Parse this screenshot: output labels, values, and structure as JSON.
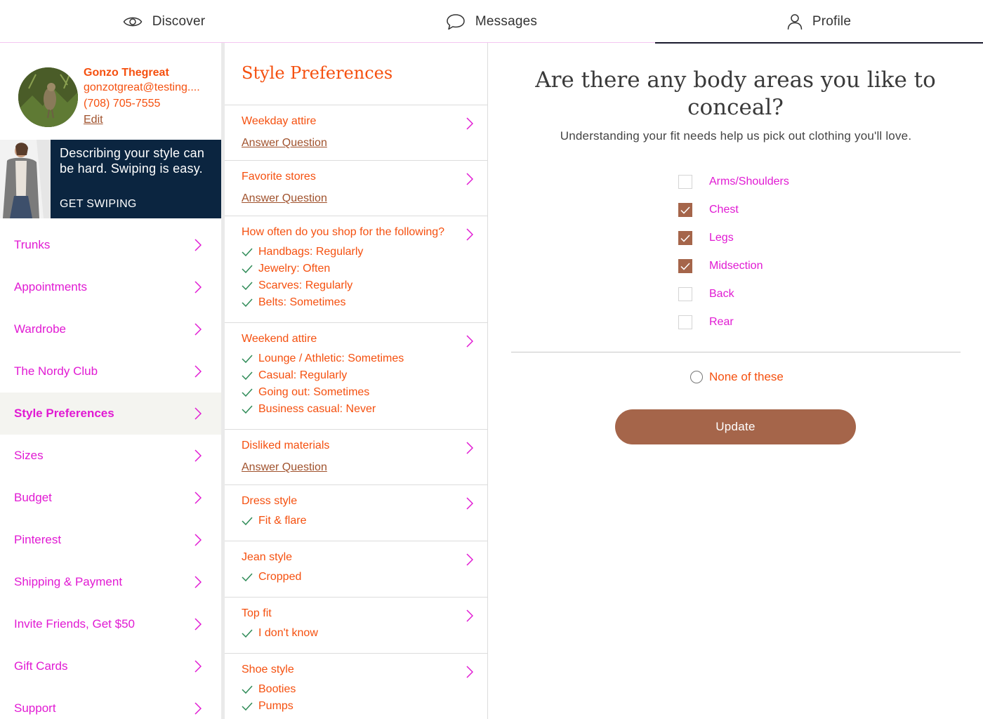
{
  "nav": {
    "tabs": [
      {
        "label": "Discover",
        "icon": "eye-icon"
      },
      {
        "label": "Messages",
        "icon": "chat-bubble-icon"
      },
      {
        "label": "Profile",
        "icon": "person-icon"
      }
    ],
    "active": "Profile"
  },
  "user": {
    "name": "Gonzo Thegreat",
    "email": "gonzotgreat@testing....",
    "phone": "(708) 705-7555",
    "edit_label": "Edit"
  },
  "promo": {
    "text": "Describing your style can be hard. Swiping is easy.",
    "cta": "GET SWIPING"
  },
  "menu": {
    "items": [
      {
        "label": "Trunks"
      },
      {
        "label": "Appointments"
      },
      {
        "label": "Wardrobe"
      },
      {
        "label": "The Nordy Club"
      },
      {
        "label": "Style Preferences",
        "active": true
      },
      {
        "label": "Sizes"
      },
      {
        "label": "Budget"
      },
      {
        "label": "Pinterest"
      },
      {
        "label": "Shipping & Payment"
      },
      {
        "label": "Invite Friends, Get $50"
      },
      {
        "label": "Gift Cards"
      },
      {
        "label": "Support"
      }
    ]
  },
  "style_prefs": {
    "title": "Style Preferences",
    "answer_label": "Answer Question",
    "questions": [
      {
        "title": "Weekday attire",
        "answers": []
      },
      {
        "title": "Favorite stores",
        "answers": []
      },
      {
        "title": "How often do you shop for the following?",
        "answers": [
          "Handbags: Regularly",
          "Jewelry: Often",
          "Scarves: Regularly",
          "Belts: Sometimes"
        ]
      },
      {
        "title": "Weekend attire",
        "answers": [
          "Lounge / Athletic: Sometimes",
          "Casual: Regularly",
          "Going out: Sometimes",
          "Business casual: Never"
        ]
      },
      {
        "title": "Disliked materials",
        "answers": []
      },
      {
        "title": "Dress style",
        "answers": [
          "Fit & flare"
        ]
      },
      {
        "title": "Jean style",
        "answers": [
          "Cropped"
        ]
      },
      {
        "title": "Top fit",
        "answers": [
          "I don't know"
        ]
      },
      {
        "title": "Shoe style",
        "answers": [
          "Booties",
          "Pumps"
        ]
      }
    ]
  },
  "question_panel": {
    "title": "Are there any body areas you like to conceal?",
    "subtitle": "Understanding your fit needs help us pick out clothing you'll love.",
    "options": [
      {
        "label": "Arms/Shoulders",
        "checked": false
      },
      {
        "label": "Chest",
        "checked": true
      },
      {
        "label": "Legs",
        "checked": true
      },
      {
        "label": "Midsection",
        "checked": true
      },
      {
        "label": "Back",
        "checked": false
      },
      {
        "label": "Rear",
        "checked": false
      }
    ],
    "none_label": "None of these",
    "none_selected": false,
    "button_label": "Update"
  },
  "colors": {
    "accent_orange": "#f5500f",
    "accent_magenta": "#e11ad3",
    "button_brown": "#a5654a",
    "promo_navy": "#0b2540"
  }
}
